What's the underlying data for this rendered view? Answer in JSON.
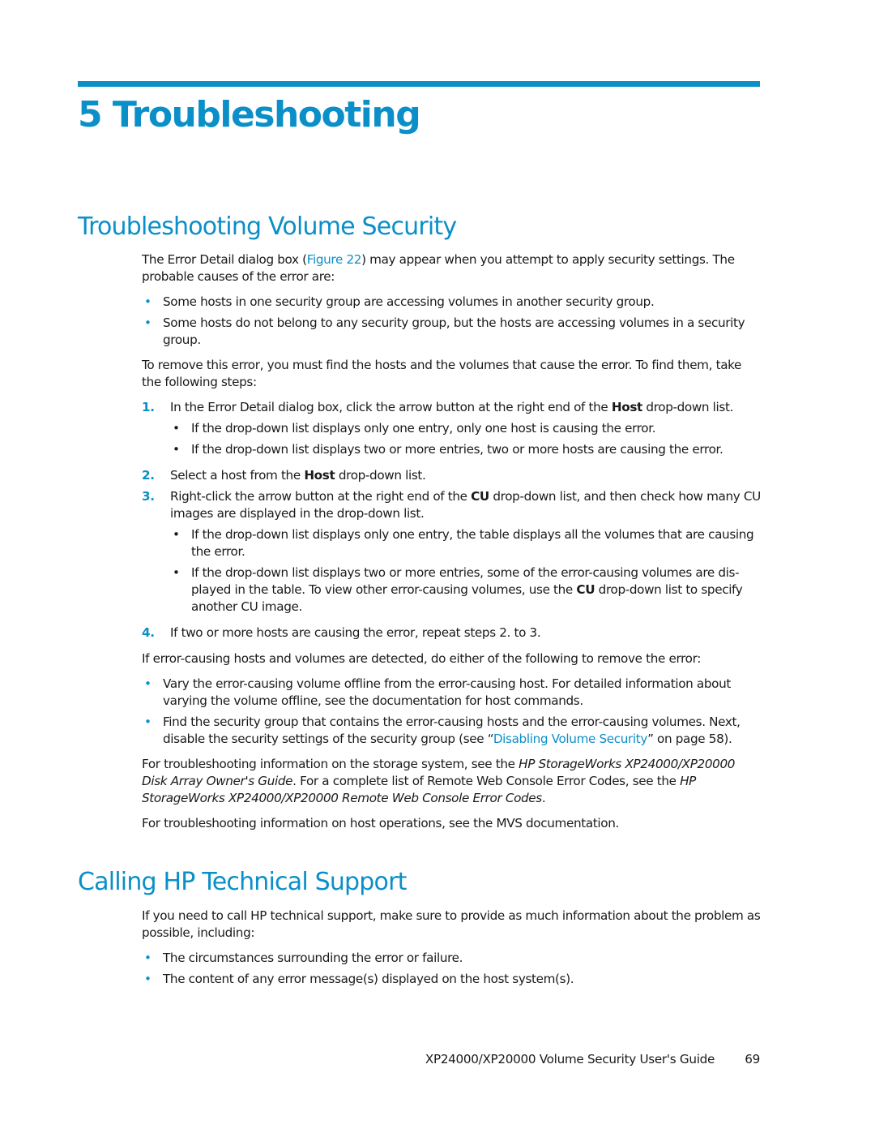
{
  "chapter": {
    "title": "5 Troubleshooting"
  },
  "section1": {
    "heading": "Troubleshooting Volume Security",
    "intro_pre": "The Error Detail dialog box (",
    "intro_link": "Figure 22",
    "intro_post": ") may appear when you attempt to apply security settings. The probable causes of the error are:",
    "causes": [
      "Some hosts in one security group are accessing volumes in another security group.",
      "Some hosts do not belong to any security group, but the hosts are accessing volumes in a security group."
    ],
    "steps_intro": "To remove this error, you must find the hosts and the volumes that cause the error. To find them, take the following steps:",
    "steps": [
      {
        "num": "1.",
        "pre": "In the Error Detail dialog box, click the arrow button at the right end of the ",
        "bold": "Host",
        "post": " drop-down list.",
        "subs": [
          "If the drop-down list displays only one entry, only one host is causing the error.",
          "If the drop-down list displays two or more entries, two or more hosts are causing the error."
        ]
      },
      {
        "num": "2.",
        "pre": "Select a host from the ",
        "bold": "Host",
        "post": " drop-down list."
      },
      {
        "num": "3.",
        "pre": "Right-click the arrow button at the right end of the ",
        "bold": "CU",
        "post": " drop-down list, and then check how many CU images are displayed in the drop-down list.",
        "sub1": "If the drop-down list displays only one entry, the table displays all the volumes that are causing the error.",
        "sub2_pre": "If the drop-down list displays two or more entries, some of the error-causing volumes are dis-played in the table. To view other error-causing volumes, use the ",
        "sub2_bold": "CU",
        "sub2_post": " drop-down list to specify another CU image."
      },
      {
        "num": "4.",
        "text": "If two or more hosts are causing the error, repeat steps 2. to 3."
      }
    ],
    "remedy_intro": "If error-causing hosts and volumes are detected, do either of the following to remove the error:",
    "remedy1": "Vary the error-causing volume offline from the error-causing host. For detailed information about varying the volume offline, see the documentation for host commands.",
    "remedy2_pre": "Find the security group that contains the error-causing hosts and the error-causing volumes. Next, disable the security settings of the security group (see “",
    "remedy2_link": "Disabling Volume Security",
    "remedy2_post": "” on page 58).",
    "storage_pre": "For troubleshooting information on the storage system, see the ",
    "storage_ital1": "HP StorageWorks XP24000/XP20000 Disk Array Owner's Guide",
    "storage_mid": ". For a complete list of Remote Web Console Error Codes, see the ",
    "storage_ital2": "HP StorageWorks XP24000/XP20000 Remote Web Console Error Codes",
    "storage_post": ".",
    "host_ops": "For troubleshooting information on host operations, see the MVS documentation."
  },
  "section2": {
    "heading": "Calling HP Technical Support",
    "intro": "If you need to call HP technical support, make sure to provide as much information about the problem as possible, including:",
    "items": [
      "The circumstances surrounding the error or failure.",
      "The content of any error message(s) displayed on the host system(s)."
    ]
  },
  "bullet_glyph": "•",
  "footer": {
    "doc_title": "XP24000/XP20000 Volume Security User's Guide",
    "page_number": "69"
  }
}
